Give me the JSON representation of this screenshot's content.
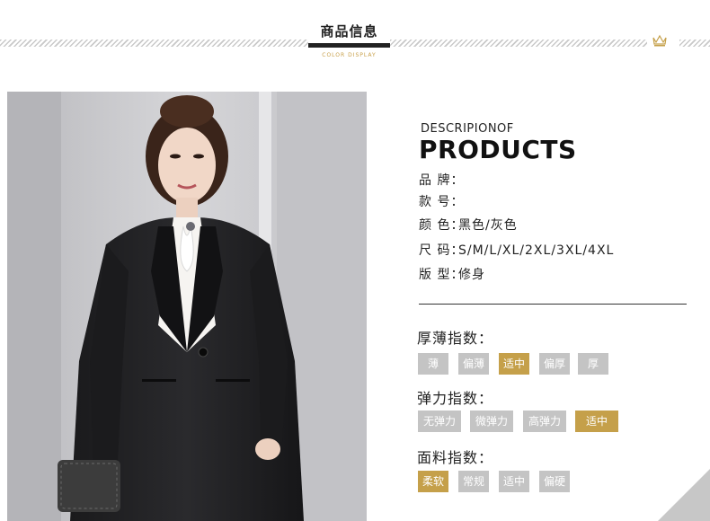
{
  "header": {
    "title": "商品信息",
    "subtitle": "COLOR DISPLAY"
  },
  "description": {
    "small": "DESCRIPIONOF",
    "big": "PRODUCTS"
  },
  "specs": [
    {
      "label": "品 牌：",
      "value": ""
    },
    {
      "label": "款 号：",
      "value": ""
    },
    {
      "label": "颜 色：",
      "value": "黑色/灰色"
    },
    {
      "label": "尺 码：",
      "value": "S/M/L/XL/2XL/3XL/4XL"
    },
    {
      "label": "版 型：",
      "value": "修身"
    }
  ],
  "indices": [
    {
      "title": "厚薄指数：",
      "options": [
        "薄",
        "偏薄",
        "适中",
        "偏厚",
        "厚"
      ],
      "selected": 2
    },
    {
      "title": "弹力指数：",
      "options": [
        "无弹力",
        "微弹力",
        "高弹力",
        "适中"
      ],
      "selected": 3
    },
    {
      "title": "面料指数：",
      "options": [
        "柔软",
        "常规",
        "适中",
        "偏硬"
      ],
      "selected": 0
    }
  ],
  "colors": {
    "accent": "#c5a04a",
    "chip": "#c4c4c4"
  }
}
